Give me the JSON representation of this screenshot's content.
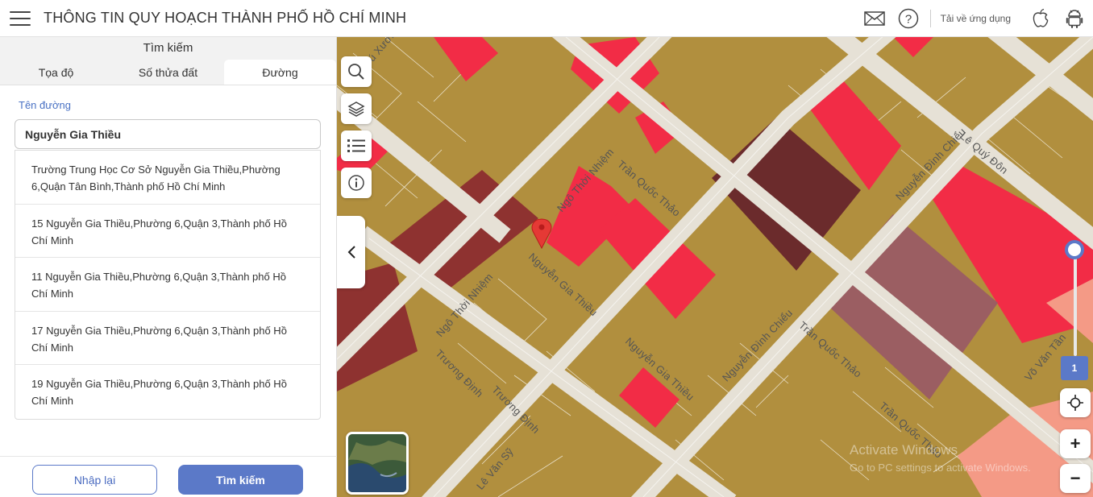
{
  "header": {
    "title": "THÔNG TIN QUY HOẠCH THÀNH PHỐ HỒ CHÍ MINH",
    "download_text": "Tải về ứng dụng"
  },
  "panel": {
    "title": "Tìm kiếm",
    "tabs": [
      {
        "label": "Tọa độ",
        "active": false
      },
      {
        "label": "Số thửa đất",
        "active": false
      },
      {
        "label": "Đường",
        "active": true
      }
    ],
    "field_label": "Tên đường",
    "input_value": "Nguyễn Gia Thiều",
    "suggestions": [
      "Trường Trung Học Cơ Sở Nguyễn Gia Thiều,Phường 6,Quận Tân Bình,Thành phố Hồ Chí Minh",
      "15 Nguyễn Gia Thiều,Phường 6,Quận 3,Thành phố Hồ Chí Minh",
      "11 Nguyễn Gia Thiều,Phường 6,Quận 3,Thành phố Hồ Chí Minh",
      "17 Nguyễn Gia Thiều,Phường 6,Quận 3,Thành phố Hồ Chí Minh",
      "19 Nguyễn Gia Thiều,Phường 6,Quận 3,Thành phố Hồ Chí Minh"
    ],
    "reset_label": "Nhập lại",
    "search_label": "Tìm kiếm"
  },
  "map": {
    "streets": {
      "ngo_thoi_nhiem_1": "Ngô Thời Nhiệm",
      "ngo_thoi_nhiem_2": "Ngô Thời Nhiệm",
      "tran_quoc_thao_1": "Trần Quốc Thảo",
      "tran_quoc_thao_2": "Trần Quốc Thảo",
      "tran_quoc_thao_3": "Trần Quốc Thảo",
      "nguyen_gia_thieu_1": "Nguyễn Gia Thiều",
      "nguyen_gia_thieu_2": "Nguyễn Gia Thiều",
      "nguyen_dinh_chieu_1": "Nguyễn Đình Chiểu",
      "nguyen_dinh_chieu_2": "Nguyễn Đình Chiểu",
      "truong_dinh_1": "Trương Định",
      "truong_dinh_2": "Trương Định",
      "le_quy_don": "Lê Quý Đôn",
      "vo_van_tan": "Võ Văn Tần",
      "tu_xuong": "Tú Xương",
      "le_van_sy": "Lê Văn Sỹ"
    },
    "zoom_level": "1",
    "zoom_fraction": 0.0,
    "watermark_title": "Activate Windows",
    "watermark_sub": "Go to PC settings to activate Windows.",
    "colors": {
      "residential": "#b18f3e",
      "commercial": "#f22c46",
      "public": "#6b2b2c",
      "road": "#e6e1d6",
      "accent": "#5b79c8"
    }
  }
}
